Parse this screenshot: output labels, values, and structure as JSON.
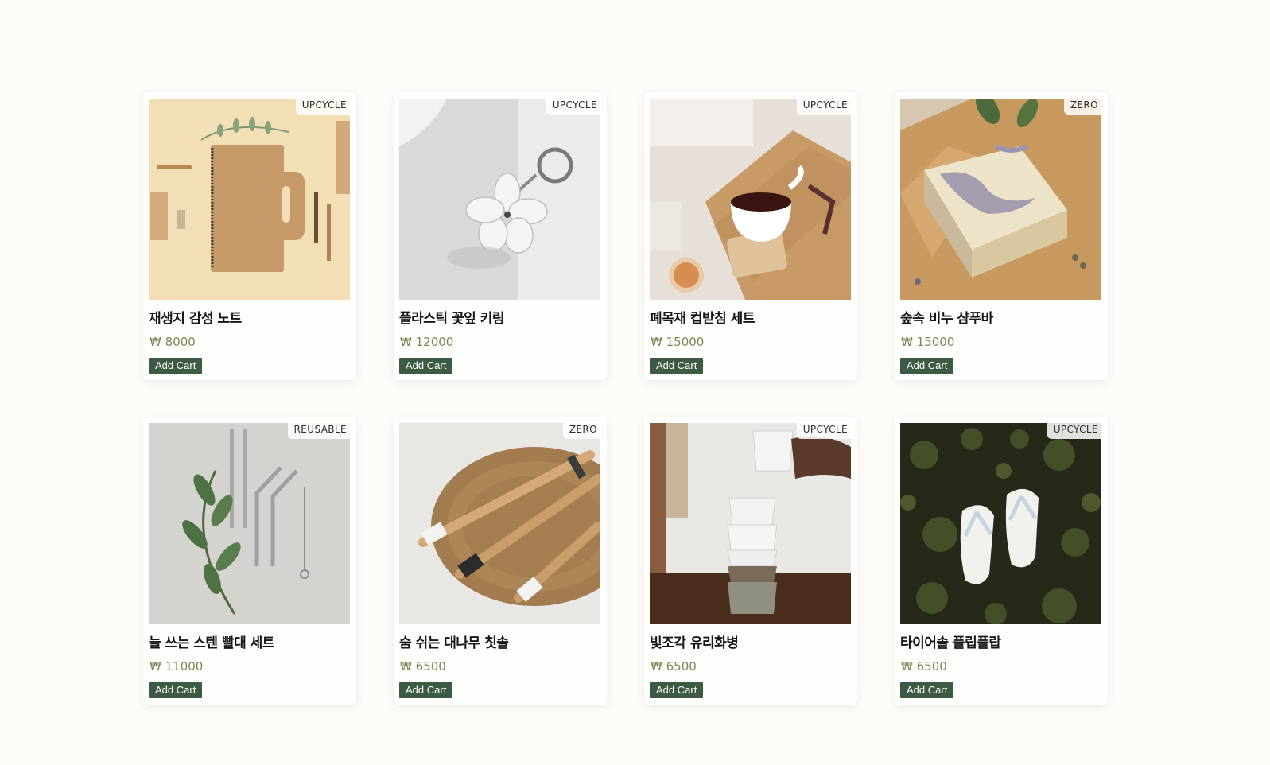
{
  "currency_symbol": "₩",
  "button_label": "Add Cart",
  "products": [
    {
      "tag": "UPCYCLE",
      "name": "재생지 감성 노트",
      "price": "8000",
      "image": "recycled-paper-notebook"
    },
    {
      "tag": "UPCYCLE",
      "name": "플라스틱 꽃잎 키링",
      "price": "12000",
      "image": "plastic-flower-keyring"
    },
    {
      "tag": "UPCYCLE",
      "name": "폐목재 컵받침 세트",
      "price": "15000",
      "image": "wood-coaster-with-cup"
    },
    {
      "tag": "ZERO",
      "name": "숲속 비누 샴푸바",
      "price": "15000",
      "image": "shampoo-bar-soap"
    },
    {
      "tag": "REUSABLE",
      "name": "늘 쓰는 스텐 빨대 세트",
      "price": "11000",
      "image": "steel-straw-set"
    },
    {
      "tag": "ZERO",
      "name": "숨 쉬는 대나무 칫솔",
      "price": "6500",
      "image": "bamboo-toothbrushes"
    },
    {
      "tag": "UPCYCLE",
      "name": "빛조각 유리화병",
      "price": "6500",
      "image": "stacked-glass-cups"
    },
    {
      "tag": "UPCYCLE",
      "name": "타이어솔 플립플랍",
      "price": "6500",
      "image": "flip-flops-on-grass"
    }
  ],
  "colors": {
    "background": "#fdfcf8",
    "price_text": "#7a8a55",
    "button_bg": "#3d5a45",
    "button_text": "#ffffff"
  }
}
